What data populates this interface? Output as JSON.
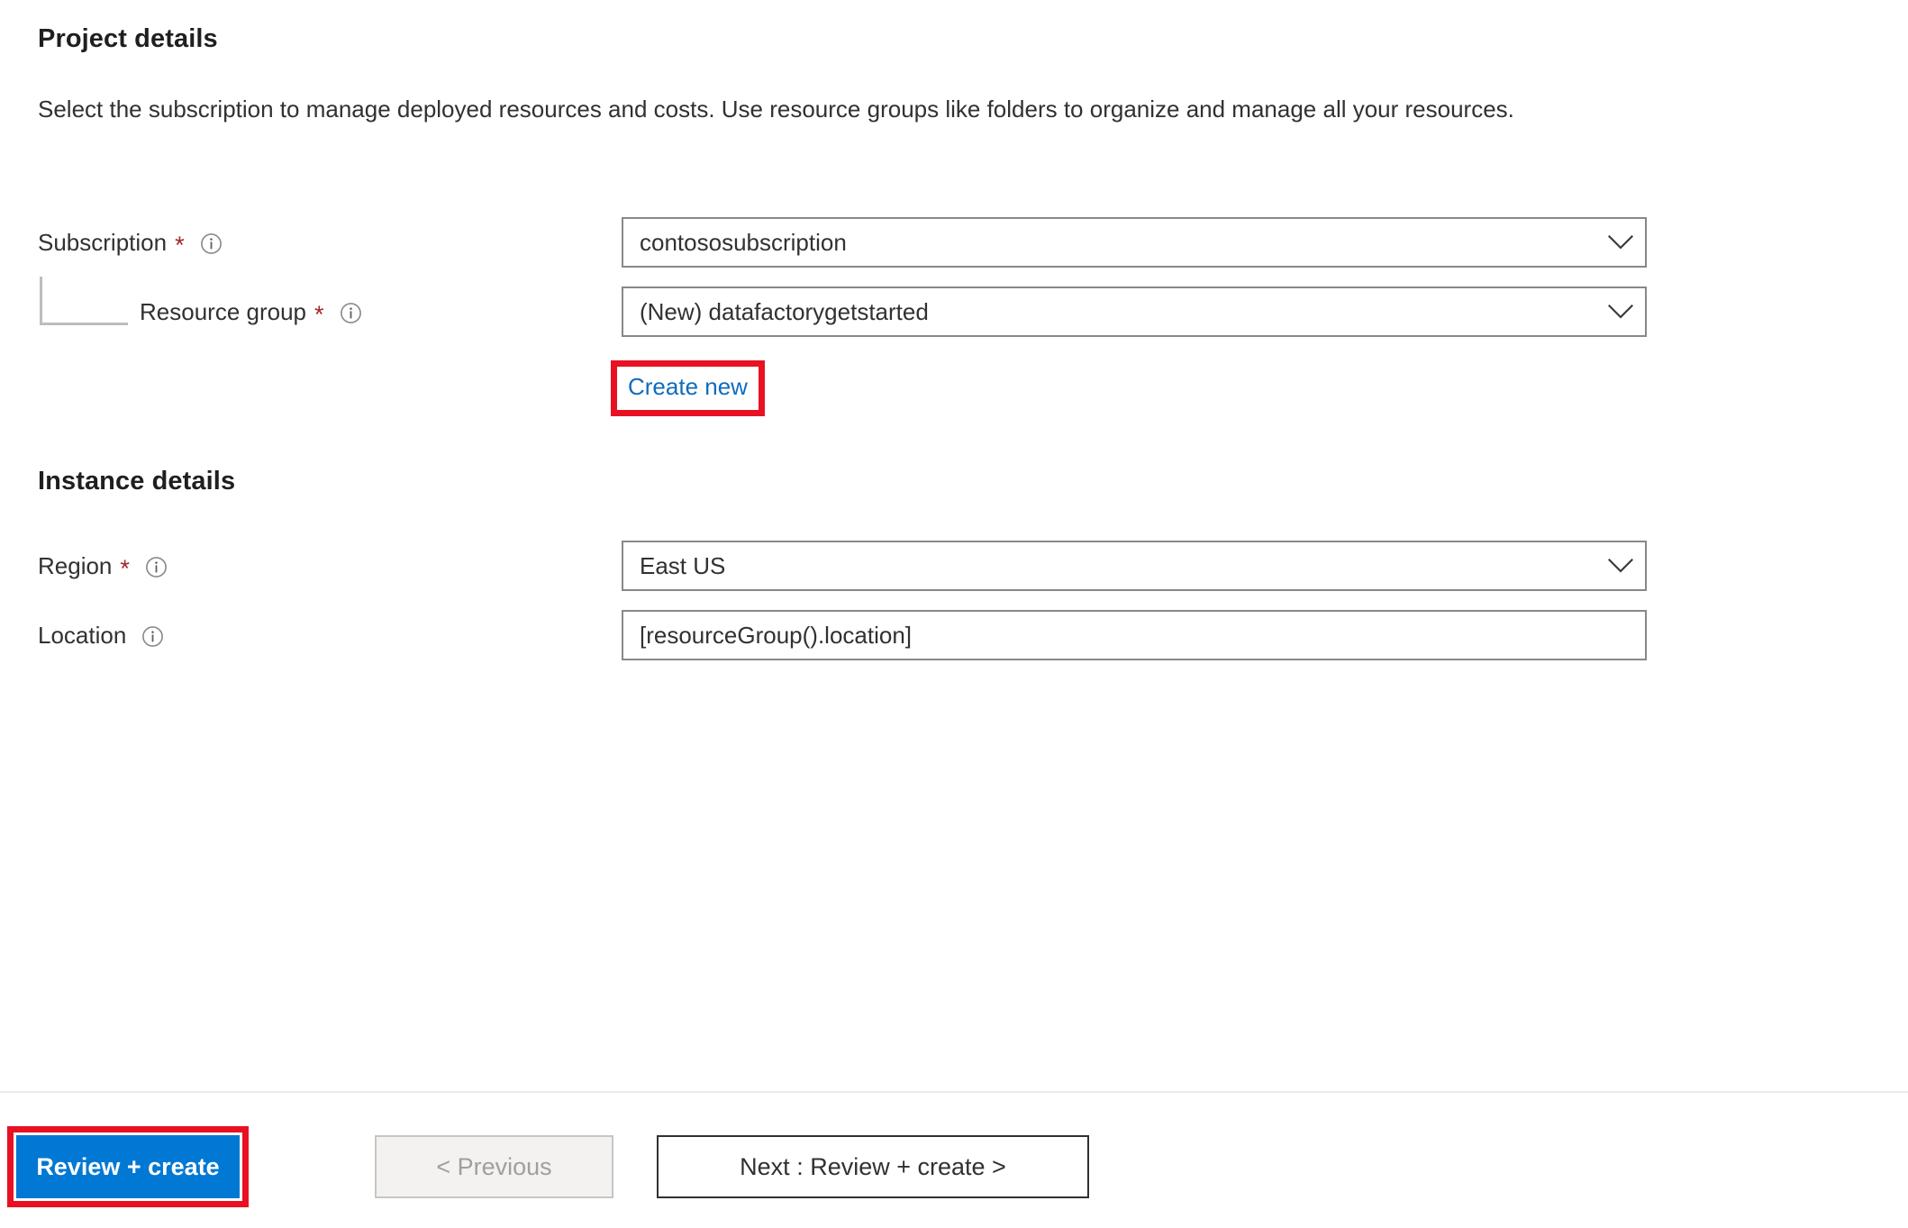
{
  "project_details": {
    "title": "Project details",
    "description": "Select the subscription to manage deployed resources and costs. Use resource groups like folders to organize and manage all your resources.",
    "fields": {
      "subscription": {
        "label": "Subscription",
        "required_marker": "*",
        "value": "contososubscription",
        "control_type": "dropdown"
      },
      "resource_group": {
        "label": "Resource group",
        "required_marker": "*",
        "value": "(New) datafactorygetstarted",
        "control_type": "dropdown",
        "create_new_link": "Create new"
      }
    }
  },
  "instance_details": {
    "title": "Instance details",
    "fields": {
      "region": {
        "label": "Region",
        "required_marker": "*",
        "value": "East US",
        "control_type": "dropdown"
      },
      "location": {
        "label": "Location",
        "required_marker": "",
        "value": "[resourceGroup().location]",
        "control_type": "textbox"
      }
    }
  },
  "footer": {
    "review_create_label": "Review + create",
    "previous_label": "< Previous",
    "next_label": "Next : Review + create >"
  },
  "icons": {
    "info": "info-icon",
    "chevron_down": "chevron-down-icon"
  },
  "colors": {
    "accent_blue": "#0078D4",
    "link_blue": "#0F6CBD",
    "highlight_red": "#E81123",
    "required_red": "#A4262C",
    "border_grey": "#8A8886",
    "text_primary": "#323130"
  }
}
